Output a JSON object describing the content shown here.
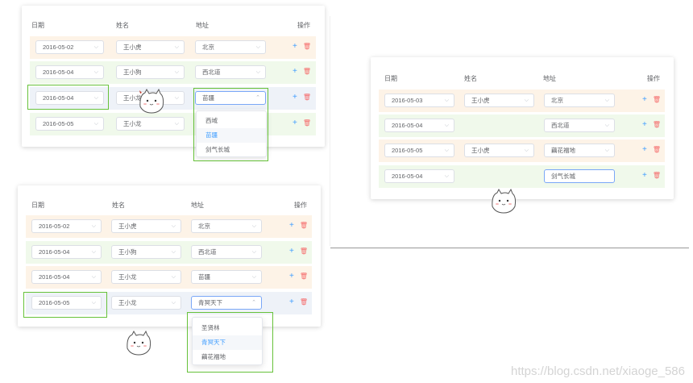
{
  "headers": {
    "date": "日期",
    "name": "姓名",
    "address": "地址",
    "actions": "操作"
  },
  "icons": {
    "plus": "+",
    "trash": "🗑",
    "chevron_down": "⌵",
    "chevron_up": "⌃"
  },
  "panel1": {
    "rows": [
      {
        "date": "2016-05-02",
        "name": "王小虎",
        "address": "北京"
      },
      {
        "date": "2016-05-04",
        "name": "王小狗",
        "address": "西北道"
      },
      {
        "date": "2016-05-04",
        "name": "王小龙",
        "address": "苗疆"
      },
      {
        "date": "2016-05-05",
        "name": "王小龙",
        "address": ""
      }
    ],
    "dropdown": [
      "西域",
      "苗疆",
      "剑气长城"
    ],
    "dropdown_selected": "苗疆"
  },
  "panel2": {
    "rows": [
      {
        "date": "2016-05-02",
        "name": "王小虎",
        "address": "北京"
      },
      {
        "date": "2016-05-04",
        "name": "王小狗",
        "address": "西北道"
      },
      {
        "date": "2016-05-04",
        "name": "王小龙",
        "address": "苗疆"
      },
      {
        "date": "2016-05-05",
        "name": "王小龙",
        "address": "青冥天下"
      }
    ],
    "dropdown": [
      "圣贤林",
      "青冥天下",
      "藕花福地"
    ],
    "dropdown_selected": "青冥天下"
  },
  "panel3": {
    "rows": [
      {
        "date": "2016-05-03",
        "name": "王小虎",
        "address": "北京"
      },
      {
        "date": "2016-05-04",
        "name": "",
        "address": "西北道"
      },
      {
        "date": "2016-05-05",
        "name": "王小虎",
        "address": "藕花福地"
      },
      {
        "date": "2016-05-04",
        "name": "",
        "address": "剑气长城"
      }
    ]
  },
  "watermark": "https://blog.csdn.net/xiaoge_586",
  "colors": {
    "row_orange": "#fdf3e7",
    "row_green": "#f0f9eb",
    "row_blue": "#eef2f8",
    "highlight": "#67c23a",
    "accent": "#409eff",
    "danger": "#f56c6c"
  }
}
